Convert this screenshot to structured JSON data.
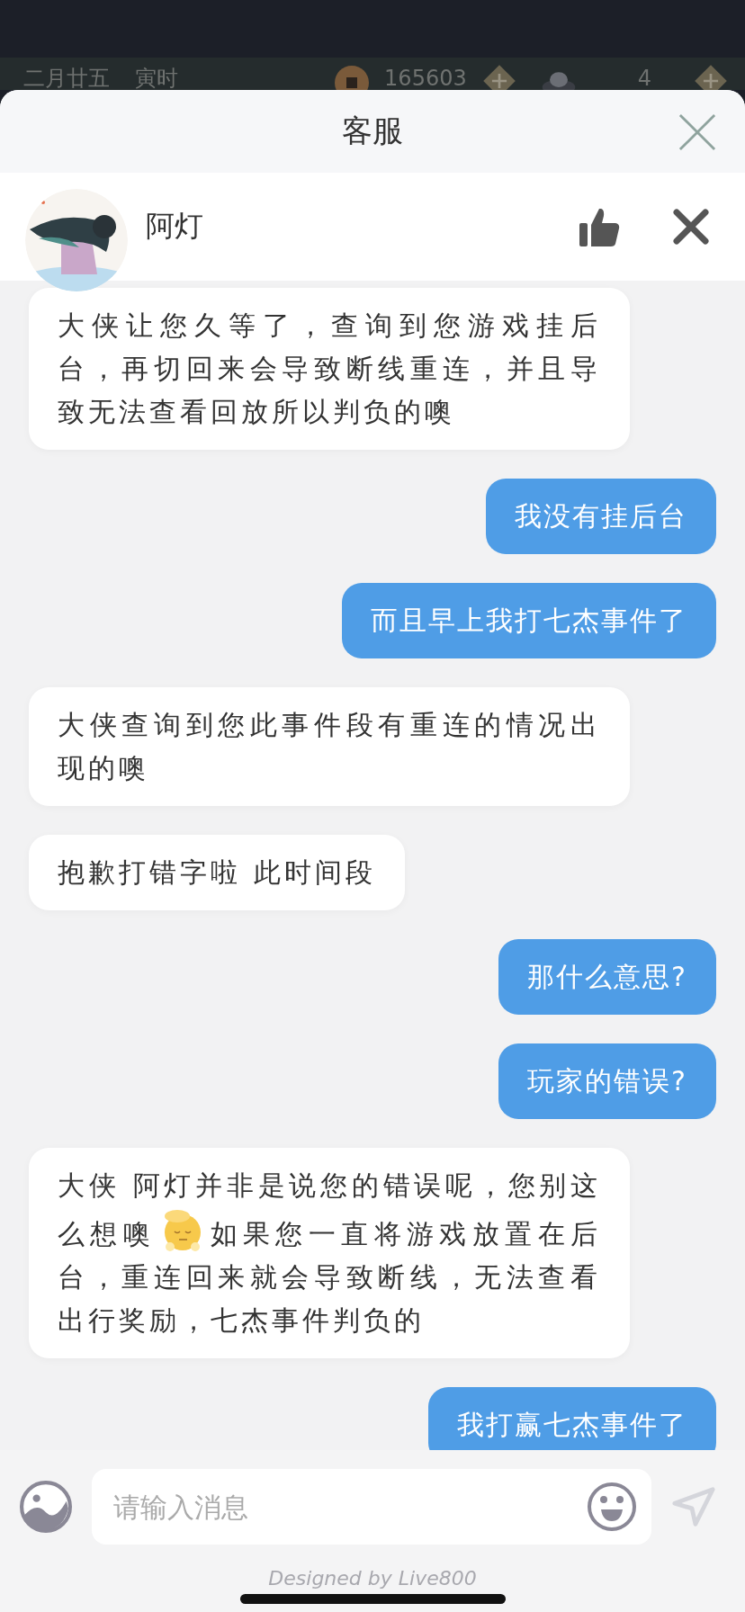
{
  "game_bar": {
    "date": "二月廿五",
    "hour": "寅时",
    "coins": "165603",
    "ingots": "4"
  },
  "header": {
    "title": "客服"
  },
  "agent": {
    "name": "阿灯"
  },
  "messages": [
    {
      "kind": "incoming",
      "segments": [
        {
          "kind": "text",
          "text": "大侠让您久等了，查询到您游戏挂后台，再切回来会导致断线重连，并且导致无法查看回放所以判负的噢"
        }
      ]
    },
    {
      "kind": "outgoing",
      "segments": [
        {
          "kind": "text",
          "text": "我没有挂后台"
        }
      ]
    },
    {
      "kind": "outgoing",
      "segments": [
        {
          "kind": "text",
          "text": "而且早上我打七杰事件了"
        }
      ]
    },
    {
      "kind": "incoming",
      "segments": [
        {
          "kind": "text",
          "text": "大侠查询到您此事件段有重连的情况出现的噢"
        }
      ]
    },
    {
      "kind": "incoming",
      "segments": [
        {
          "kind": "text",
          "text": "抱歉打错字啦 此时间段"
        }
      ]
    },
    {
      "kind": "outgoing",
      "segments": [
        {
          "kind": "text",
          "text": "那什么意思?"
        }
      ]
    },
    {
      "kind": "outgoing",
      "segments": [
        {
          "kind": "text",
          "text": "玩家的错误?"
        }
      ]
    },
    {
      "kind": "incoming",
      "segments": [
        {
          "kind": "text",
          "text": "大侠 阿灯并非是说您的错误呢，您别这么想噢"
        },
        {
          "kind": "sticker"
        },
        {
          "kind": "text",
          "text": "如果您一直将游戏放置在后台，重连回来就会导致断线，无法查看出行奖励，七杰事件判负的"
        }
      ]
    },
    {
      "kind": "outgoing",
      "segments": [
        {
          "kind": "text",
          "text": "我打赢七杰事件了"
        }
      ]
    }
  ],
  "input": {
    "placeholder": "请输入消息"
  },
  "footer": {
    "text": "Designed by Live800"
  }
}
